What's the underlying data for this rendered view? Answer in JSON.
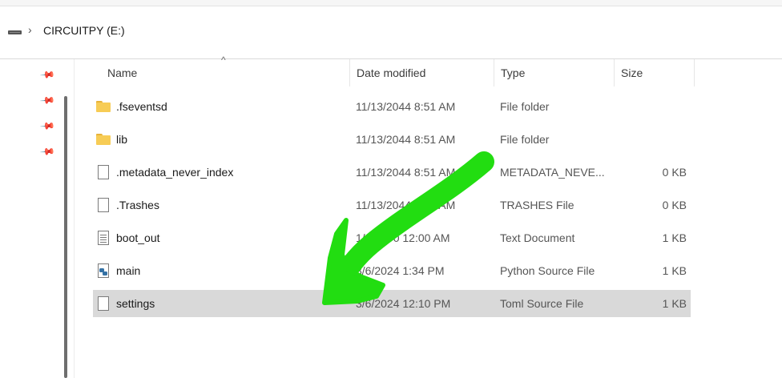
{
  "address": {
    "path": "CIRCUITPY (E:)"
  },
  "columns": {
    "name": "Name",
    "date": "Date modified",
    "type": "Type",
    "size": "Size"
  },
  "files": [
    {
      "name": ".fseventsd",
      "date": "11/13/2044 8:51 AM",
      "type": "File folder",
      "size": "",
      "icon": "folder-icon"
    },
    {
      "name": "lib",
      "date": "11/13/2044 8:51 AM",
      "type": "File folder",
      "size": "",
      "icon": "folder-icon"
    },
    {
      "name": ".metadata_never_index",
      "date": "11/13/2044 8:51 AM",
      "type": "METADATA_NEVE...",
      "size": "0 KB",
      "icon": "file-icon"
    },
    {
      "name": ".Trashes",
      "date": "11/13/2044 8:51 AM",
      "type": "TRASHES File",
      "size": "0 KB",
      "icon": "file-icon"
    },
    {
      "name": "boot_out",
      "date": "1/1/2000 12:00 AM",
      "type": "Text Document",
      "size": "1 KB",
      "icon": "text-file-icon"
    },
    {
      "name": "main",
      "date": "3/6/2024 1:34 PM",
      "type": "Python Source File",
      "size": "1 KB",
      "icon": "python-file-icon"
    },
    {
      "name": "settings",
      "date": "3/6/2024 12:10 PM",
      "type": "Toml Source File",
      "size": "1 KB",
      "icon": "file-icon",
      "selected": true
    }
  ],
  "annotation": {
    "color": "#22dd11"
  }
}
